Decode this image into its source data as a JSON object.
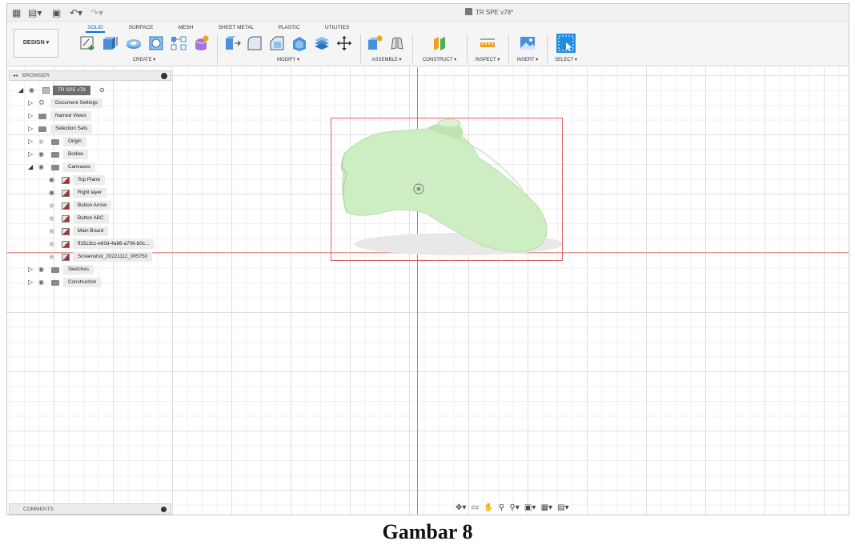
{
  "document": {
    "title": "TR SPE v78*"
  },
  "workspace": {
    "button_label": "DESIGN ▾"
  },
  "tabs": [
    {
      "label": "SOLID"
    },
    {
      "label": "SURFACE"
    },
    {
      "label": "MESH"
    },
    {
      "label": "SHEET METAL"
    },
    {
      "label": "PLASTIC"
    },
    {
      "label": "UTILITIES"
    }
  ],
  "tool_groups": [
    {
      "label": "CREATE ▾"
    },
    {
      "label": "MODIFY ▾"
    },
    {
      "label": "ASSEMBLE ▾"
    },
    {
      "label": "CONSTRUCT ▾"
    },
    {
      "label": "INSPECT ▾"
    },
    {
      "label": "INSERT ▾"
    },
    {
      "label": "SELECT ▾"
    }
  ],
  "browser": {
    "title": "BROWSER",
    "root": "TR SPE v78",
    "items": [
      {
        "label": "Document Settings"
      },
      {
        "label": "Named Views"
      },
      {
        "label": "Selection Sets"
      },
      {
        "label": "Origin"
      },
      {
        "label": "Bodies"
      },
      {
        "label": "Canvases"
      },
      {
        "label": "Top Plane"
      },
      {
        "label": "Right layer"
      },
      {
        "label": "Button Arrow"
      },
      {
        "label": "Button ABC"
      },
      {
        "label": "Main Board"
      },
      {
        "label": "ff15c3cc-e60d-4a86-a706-b0c..."
      },
      {
        "label": "Screenshot_20221112_005750"
      },
      {
        "label": "Sketches"
      },
      {
        "label": "Construction"
      }
    ]
  },
  "comments": {
    "label": "COMMENTS"
  },
  "caption": "Gambar 8",
  "colors": {
    "accent": "#0a6fd6",
    "x_axis": "#e59a9a",
    "y_axis": "#8f86d8",
    "model": "#cfeec6",
    "bbox": "#e06060"
  }
}
